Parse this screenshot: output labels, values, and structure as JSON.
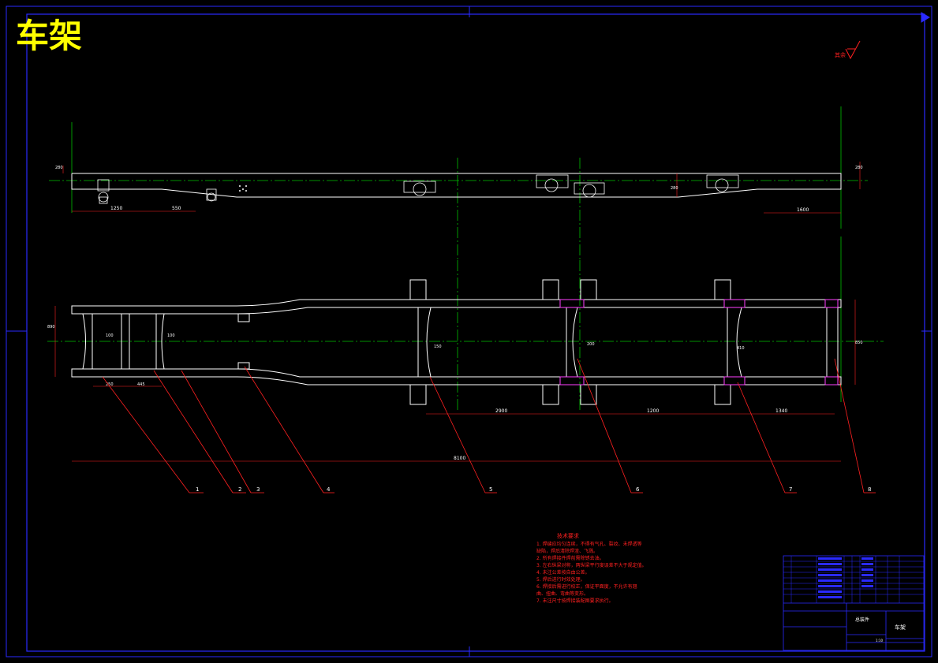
{
  "title": "车架",
  "colors": {
    "background": "#000000",
    "frame": "#2a2aff",
    "outline": "#ffffff",
    "centerline": "#00c000",
    "leader": "#ff2020",
    "highlight": "#ff40ff",
    "note": "#ff2020",
    "title": "#ffff00"
  },
  "dimensions": {
    "side_left_1": "1250",
    "side_left_2": "550",
    "side_right": "1600",
    "side_height_left": "280",
    "side_height_right": "280",
    "side_height_mid": "280",
    "plan_a": "250",
    "plan_b": "445",
    "plan_c": "100",
    "plan_d": "100",
    "plan_e": "150",
    "plan_f": "200",
    "plan_g": "410",
    "plan_span_1": "2900",
    "plan_span_2": "1200",
    "plan_span_3": "1340",
    "plan_overall": "8100",
    "plan_width_left": "890",
    "plan_width_right": "850"
  },
  "part_labels": [
    "1",
    "2",
    "3",
    "4",
    "5",
    "6",
    "7",
    "8"
  ],
  "tech_notes": {
    "heading": "技术要求",
    "lines": [
      "1. 焊缝应均匀连续，不得有气孔、裂纹、未焊透等",
      "   缺陷，焊后清除焊渣、飞溅。",
      "2. 所有焊接件焊前需除锈去油。",
      "3. 左右纵梁对称，两纵梁平行度误差不大于规定值。",
      "4. 未注公差按自由公差。",
      "5. 焊后进行时效处理。",
      "6. 焊接后需进行校正，保证平面度，不允许有翘",
      "   曲、扭曲、弯曲等变形。",
      "7. 未注尺寸按焊接装配图要求执行。"
    ]
  },
  "title_block": {
    "drawing_name": "车架",
    "assembly_label": "总装件",
    "scale": "1:10"
  },
  "roughness_mark": "其余"
}
